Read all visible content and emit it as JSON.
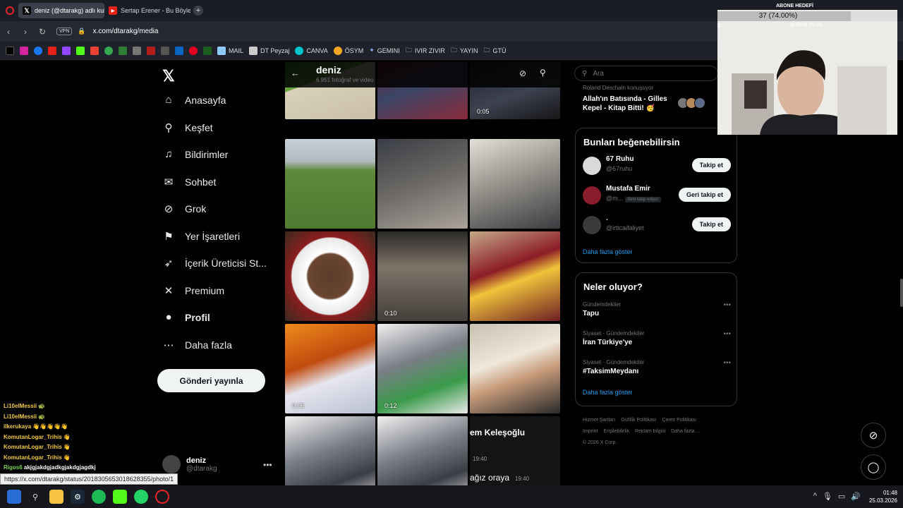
{
  "browser": {
    "tabs": [
      {
        "label": "deniz (@dtarakg) adlı kullanıcı",
        "icon": "x-icon",
        "active": true
      },
      {
        "label": "Sertap Erener - Bu Böyle (Officia",
        "icon": "youtube-icon",
        "active": false
      }
    ],
    "url": "x.com/dtarakg/media",
    "vpn": "VPN",
    "bookmarks": [
      "MAIL",
      "DT Peyzaj",
      "CANVA",
      "ÖSYM",
      "GEMINI",
      "IVIR ZIVIR",
      "YAYIN",
      "GTÜ"
    ]
  },
  "left_nav": {
    "items": [
      {
        "label": "Anasayfa",
        "icon": "home-icon",
        "glyph": "⌂"
      },
      {
        "label": "Keşfet",
        "icon": "search-icon",
        "glyph": "⚲"
      },
      {
        "label": "Bildirimler",
        "icon": "bell-icon",
        "glyph": "♫"
      },
      {
        "label": "Sohbet",
        "icon": "mail-icon",
        "glyph": "✉"
      },
      {
        "label": "Grok",
        "icon": "grok-icon",
        "glyph": "⊘"
      },
      {
        "label": "Yer İşaretleri",
        "icon": "bookmark-icon",
        "glyph": "⚑"
      },
      {
        "label": "İçerik Üreticisi St...",
        "icon": "rocket-icon",
        "glyph": "➶"
      },
      {
        "label": "Premium",
        "icon": "x-icon",
        "glyph": "✕"
      },
      {
        "label": "Profil",
        "icon": "profile-icon",
        "glyph": "●"
      },
      {
        "label": "Daha fazla",
        "icon": "more-icon",
        "glyph": "⋯"
      }
    ],
    "post_button": "Gönderi yayınla",
    "account": {
      "name": "deniz",
      "handle": "@dtarakg"
    }
  },
  "profile_header": {
    "name": "deniz",
    "subtitle": "6.951 fotoğraf ve video"
  },
  "media": [
    {
      "duration": ""
    },
    {
      "duration": ""
    },
    {
      "duration": "0:05"
    },
    {
      "duration": ""
    },
    {
      "duration": ""
    },
    {
      "duration": ""
    },
    {
      "duration": ""
    },
    {
      "duration": "0:10"
    },
    {
      "duration": ""
    },
    {
      "duration": "0:06"
    },
    {
      "duration": "0:12"
    },
    {
      "duration": ""
    },
    {
      "duration": ""
    },
    {
      "duration": ""
    }
  ],
  "media_chat_cell": {
    "title": "em Keleşoğlu",
    "time1": "19:40",
    "text": "ağız oraya",
    "time2": "19:40"
  },
  "right": {
    "search_placeholder": "Ara",
    "top_trend": {
      "who": "Roland Deschain konuşuyor",
      "title": "Allah'ın Batısında - Gilles Kepel - Kitap Bitti! 🥳"
    },
    "suggestions_title": "Bunları beğenebilirsin",
    "suggestions": [
      {
        "name": "67 Ruhu",
        "handle": "@67ruhu",
        "tag": "",
        "button": "Takip et"
      },
      {
        "name": "Mustafa Emir",
        "handle": "@m...",
        "tag": "Seni takip ediyor",
        "button": "Geri takip et"
      },
      {
        "name": ".",
        "handle": "@irticaifaliyet",
        "tag": "",
        "button": "Takip et"
      }
    ],
    "show_more": "Daha fazla göster",
    "whats_happening": "Neler oluyor?",
    "trends": [
      {
        "category": "Gündemdekiler",
        "name": "Tapu"
      },
      {
        "category": "Siyaset · Gündemdekiler",
        "name": "İran Türkiye'ye"
      },
      {
        "category": "Siyaset · Gündemdekiler",
        "name": "#TaksimMeydanı"
      }
    ],
    "show_more2": "Daha fazla göster",
    "footer": [
      "Hizmet Şartları",
      "Gizlilik Politikası",
      "Çerez Politikası",
      "Imprint",
      "Erişilebilirlik",
      "Reklam bilgisi",
      "Daha fazla ...",
      "© 2026 X Corp."
    ]
  },
  "overlay": {
    "goal_title": "ABONE HEDEFİ",
    "goal_text": "37 (74.00%)",
    "goal_fraction": 0.74,
    "goal_start": "0",
    "goal_sub": "36 DAYS TO GO"
  },
  "chat": [
    {
      "user": "Li10elMessii",
      "msg": "🐢"
    },
    {
      "user": "Li10elMessii",
      "msg": "🐢"
    },
    {
      "user": "ilkerukaya",
      "msg": "👋👋👋👋👋"
    },
    {
      "user": "KomutanLogar_Trihis",
      "msg": "👋"
    },
    {
      "user": "KomutanLogar_Trihis",
      "msg": "👋"
    },
    {
      "user": "KomutanLogar_Trihis",
      "msg": "👋"
    },
    {
      "user": "Rigos6",
      "msg": "akjgjakdgjadkgjakdgjagdkj"
    },
    {
      "user": "Li10elMessii",
      "msg": "🐢"
    }
  ],
  "status_url": "https://x.com/dtarakg/status/2018305653018628355/photo/1",
  "taskbar": {
    "time": "01:48",
    "date": "25.03.2026"
  }
}
